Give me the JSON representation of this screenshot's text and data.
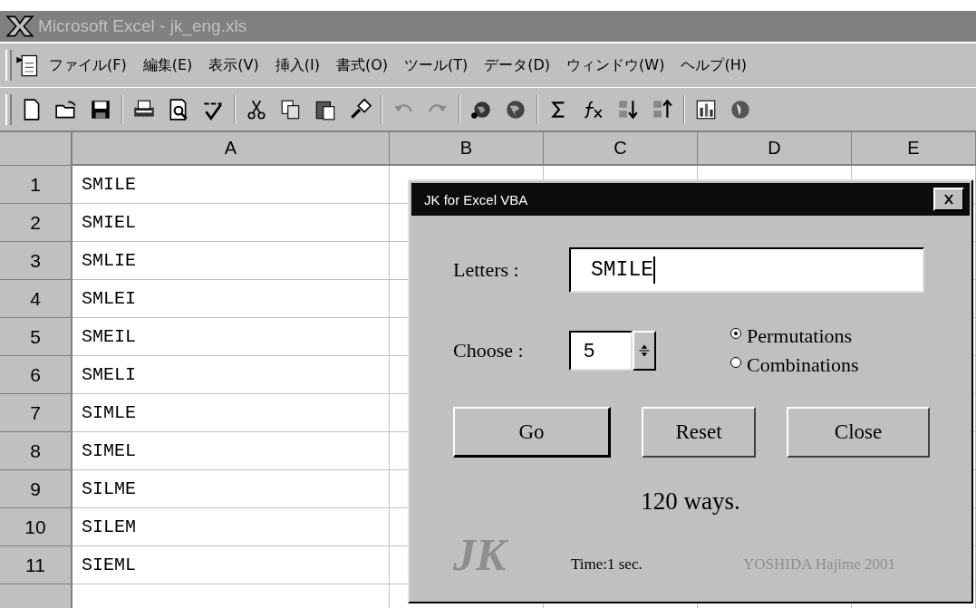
{
  "window": {
    "title": "Microsoft Excel - jk_eng.xls"
  },
  "menu": [
    "ファイル(F)",
    "編集(E)",
    "表示(V)",
    "挿入(I)",
    "書式(O)",
    "ツール(T)",
    "データ(D)",
    "ウィンドウ(W)",
    "ヘルプ(H)"
  ],
  "sheet": {
    "columns": [
      "A",
      "B",
      "C",
      "D",
      "E"
    ],
    "rows": [
      {
        "number": "1",
        "a": "SMILE"
      },
      {
        "number": "2",
        "a": "SMIEL"
      },
      {
        "number": "3",
        "a": "SMLIE"
      },
      {
        "number": "4",
        "a": "SMLEI"
      },
      {
        "number": "5",
        "a": "SMEIL"
      },
      {
        "number": "6",
        "a": "SMELI"
      },
      {
        "number": "7",
        "a": "SIMLE"
      },
      {
        "number": "8",
        "a": "SIMEL"
      },
      {
        "number": "9",
        "a": "SILME"
      },
      {
        "number": "10",
        "a": "SILEM"
      },
      {
        "number": "11",
        "a": "SIEML"
      }
    ]
  },
  "dialog": {
    "title": "JK for Excel VBA",
    "letters_label": "Letters :",
    "letters_value": "SMILE",
    "choose_label": "Choose :",
    "choose_value": "5",
    "options": [
      {
        "label": "Permutations",
        "selected": true
      },
      {
        "label": "Combinations",
        "selected": false
      }
    ],
    "buttons": [
      {
        "label": "Go",
        "default": true
      },
      {
        "label": "Reset",
        "default": false
      },
      {
        "label": "Close",
        "default": false
      }
    ],
    "result": "120 ways.",
    "logo": "JK",
    "time": "Time:1 sec.",
    "credit": "YOSHIDA Hajime 2001"
  }
}
